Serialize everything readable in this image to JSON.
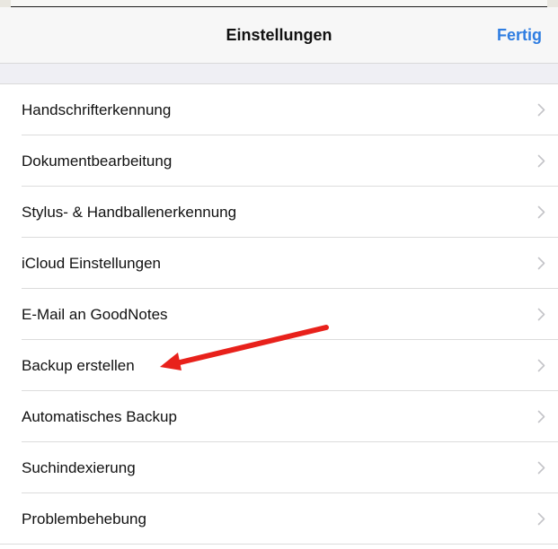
{
  "nav": {
    "title": "Einstellungen",
    "done_label": "Fertig"
  },
  "settings": {
    "items": [
      {
        "label": "Handschrifterkennung",
        "icon": "chevron-right-icon"
      },
      {
        "label": "Dokumentbearbeitung",
        "icon": "chevron-right-icon"
      },
      {
        "label": "Stylus- & Handballenerkennung",
        "icon": "chevron-right-icon"
      },
      {
        "label": "iCloud Einstellungen",
        "icon": "chevron-right-icon"
      },
      {
        "label": "E-Mail an GoodNotes",
        "icon": "chevron-right-icon"
      },
      {
        "label": "Backup erstellen",
        "icon": "chevron-right-icon"
      },
      {
        "label": "Automatisches Backup",
        "icon": "chevron-right-icon"
      },
      {
        "label": "Suchindexierung",
        "icon": "chevron-right-icon"
      },
      {
        "label": "Problembehebung",
        "icon": "chevron-right-icon"
      }
    ]
  },
  "annotation": {
    "icon": "red-arrow-icon",
    "points_to": "Backup erstellen",
    "color": "#e8211b"
  },
  "colors": {
    "accent": "#2f7de1",
    "navbar_bg": "#f7f7f7",
    "group_gap_bg": "#efeff4",
    "separator": "#dcdcdc",
    "chevron": "#c4c4c8"
  }
}
